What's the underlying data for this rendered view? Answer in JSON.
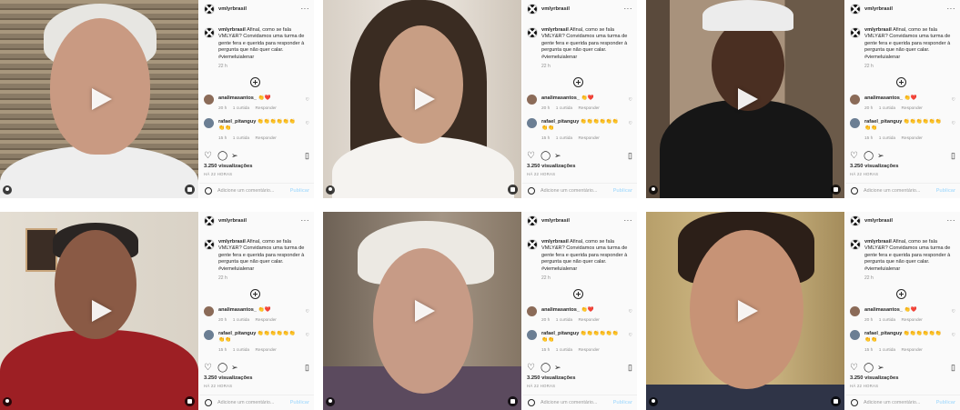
{
  "post": {
    "handle": "vmlyrbrasil",
    "caption_text": "Afinal, como se fala VMLY&R? Convidamos uma turma de gente fera e querida para responder à pergunta que não quer calar. #viemeluialenar",
    "caption_time": "22 h",
    "comments": [
      {
        "user": "analimasantos_",
        "text": "👏❤️",
        "time": "20 h",
        "likes": "1 curtida",
        "reply": "Responder"
      },
      {
        "user": "rafael_pitanguy",
        "text": "👏👏👏👏👏👏👏👏",
        "time": "15 h",
        "likes": "1 curtida",
        "reply": "Responder"
      }
    ],
    "views": "3.250 visualizações",
    "posted_ago": "HÁ 22 HORAS",
    "comment_placeholder": "Adicione um comentário...",
    "publish_label": "Publicar"
  },
  "icons": {
    "like": "heart-icon",
    "comment": "comment-icon",
    "share": "share-icon",
    "save": "bookmark-icon",
    "play": "play-icon",
    "more": "more-icon",
    "add": "plus-circle-icon",
    "emoji": "emoji-icon"
  },
  "colors": {
    "publish": "#b2dffc",
    "meta": "#8e8e8e",
    "panel_bg": "#fafafa"
  },
  "cards": [
    {
      "scene": "s1"
    },
    {
      "scene": "s2"
    },
    {
      "scene": "s3"
    },
    {
      "scene": "s4"
    },
    {
      "scene": "s5"
    },
    {
      "scene": "s6"
    }
  ]
}
